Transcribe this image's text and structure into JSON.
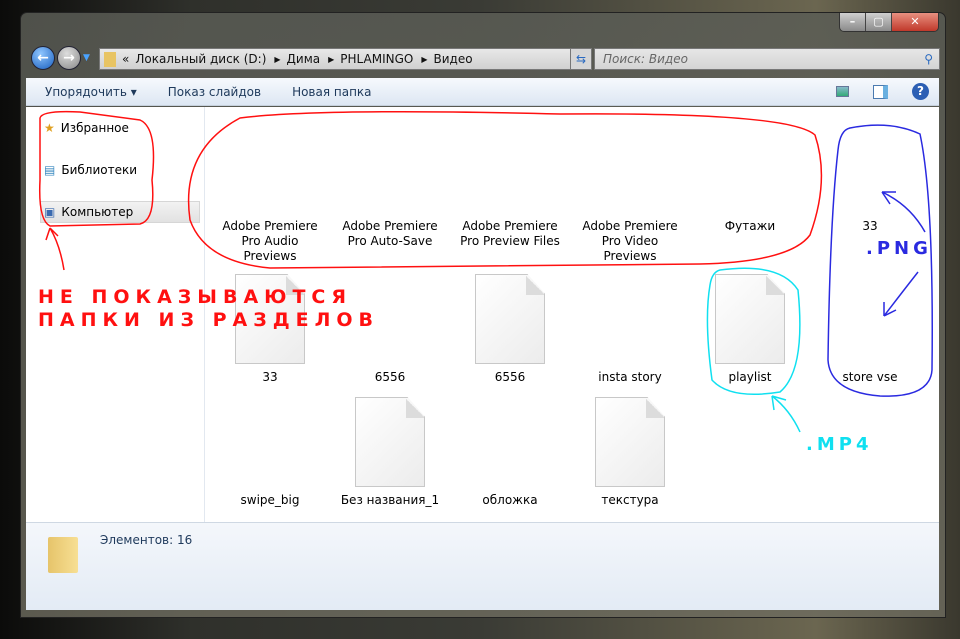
{
  "window": {
    "minimize": "–",
    "maximize": "▢",
    "close": "✕"
  },
  "address": {
    "overflow": "«",
    "crumbs": [
      "Локальный диск (D:)",
      "Дима",
      "PHLAMINGO",
      "Видео"
    ]
  },
  "search": {
    "placeholder": "Поиск: Видео"
  },
  "toolbar": {
    "organize": "Упорядочить ▾",
    "slideshow": "Показ слайдов",
    "new_folder": "Новая папка"
  },
  "sidebar": {
    "items": [
      {
        "label": "Избранное"
      },
      {
        "label": "Библиотеки"
      },
      {
        "label": "Компьютер"
      }
    ]
  },
  "folders": [
    "Adobe Premiere Pro Audio Previews",
    "Adobe Premiere Pro Auto-Save",
    "Adobe Premiere Pro Preview Files",
    "Adobe Premiere Pro Video Previews",
    "Футажи",
    "33"
  ],
  "files_row1": [
    "33",
    "6556",
    "6556",
    "insta story",
    "playlist",
    "store vse"
  ],
  "files_row2": [
    "swipe_big",
    "Без названия_1",
    "обложка",
    "текстура"
  ],
  "status": {
    "count": "Элементов: 16"
  },
  "annotations": {
    "red_line1": "НЕ ПОКАЗЫВАЮТСЯ",
    "red_line2": "ПАПКИ ИЗ РАЗДЕЛОВ",
    "blue": ".PNG",
    "cyan": ".MP4"
  },
  "colors": {
    "red": "#ff1010",
    "blue": "#2a2ae0",
    "cyan": "#10e0f0"
  }
}
